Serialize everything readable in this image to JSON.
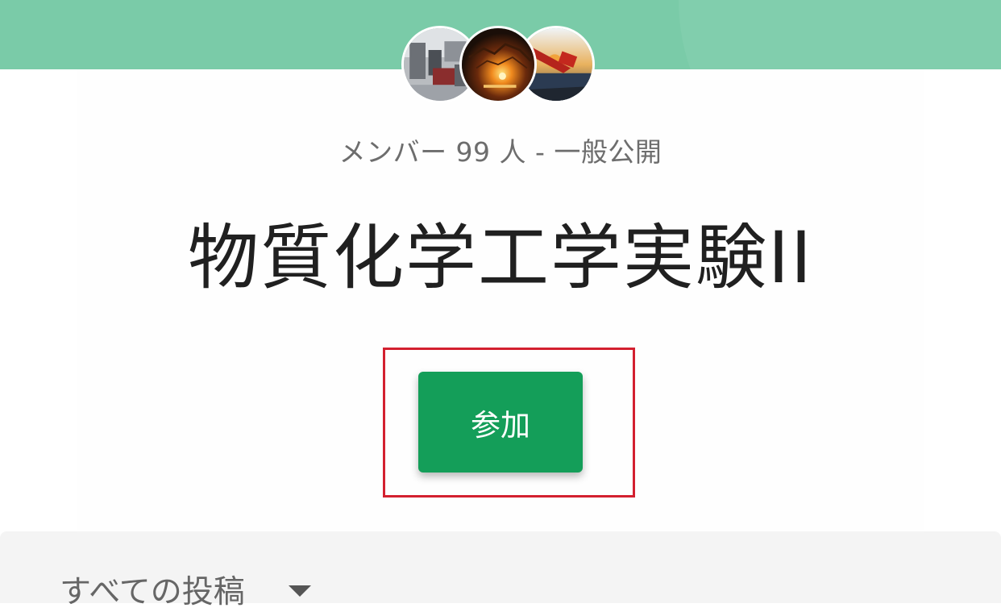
{
  "group": {
    "meta": "メンバー 99 人 - 一般公開",
    "title": "物質化学工学実験II",
    "join_label": "参加"
  },
  "feed": {
    "filter_label": "すべての投稿",
    "filter_icon": "chevron-down-icon"
  },
  "colors": {
    "header": "#7acba8",
    "button": "#149e59",
    "highlight": "#d3202f"
  },
  "avatars": [
    {
      "name": "member-avatar-lab"
    },
    {
      "name": "member-avatar-fire"
    },
    {
      "name": "member-avatar-sunset"
    }
  ]
}
